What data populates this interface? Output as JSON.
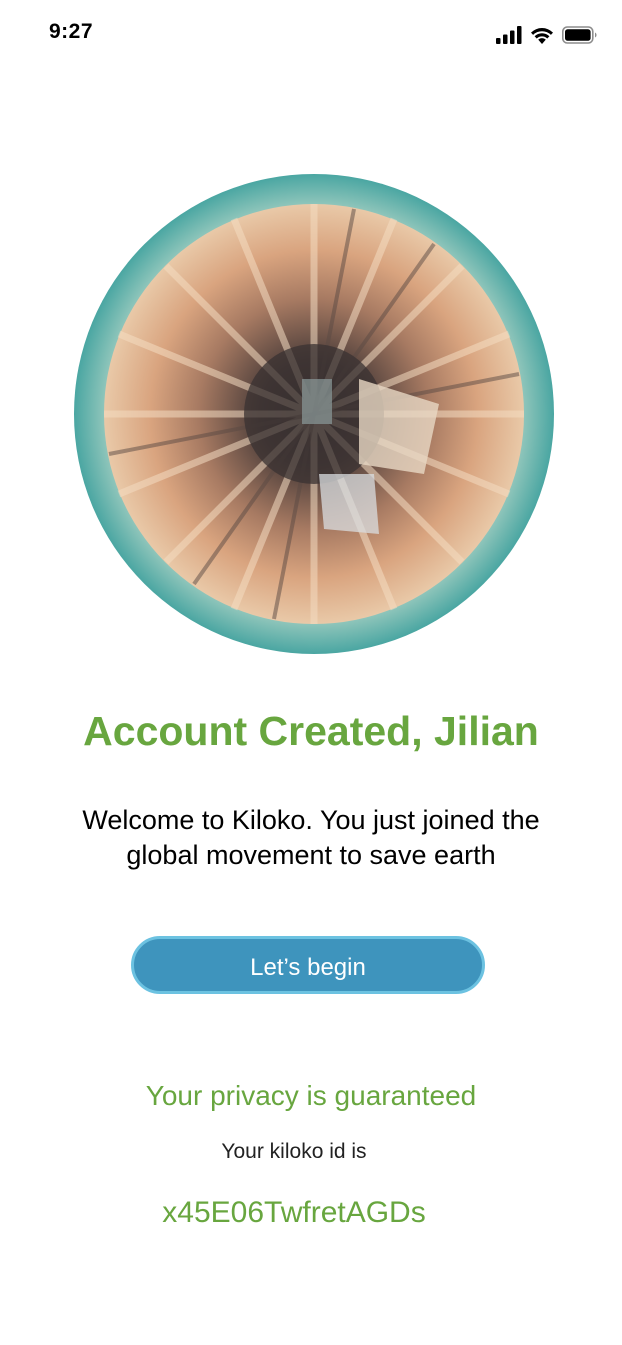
{
  "status_bar": {
    "time": "9:27",
    "icons": [
      "cellular-signal-icon",
      "wifi-icon",
      "battery-icon"
    ]
  },
  "hero": {
    "image": "tiny-planet-city-image"
  },
  "title": "Account Created, Jilian",
  "welcome": {
    "line1": "Welcome to Kiloko. You just joined the",
    "line2": "global movement to save earth"
  },
  "begin_button": {
    "label": "Let’s begin"
  },
  "privacy": {
    "text": "Your privacy is guaranteed"
  },
  "kiloko_id": {
    "label": "Your kiloko id is",
    "value": "x45E06TwfretAGDs"
  },
  "colors": {
    "accent_green": "#68a63f",
    "button_blue": "#3e94bd",
    "button_border": "#6cc2e1"
  }
}
